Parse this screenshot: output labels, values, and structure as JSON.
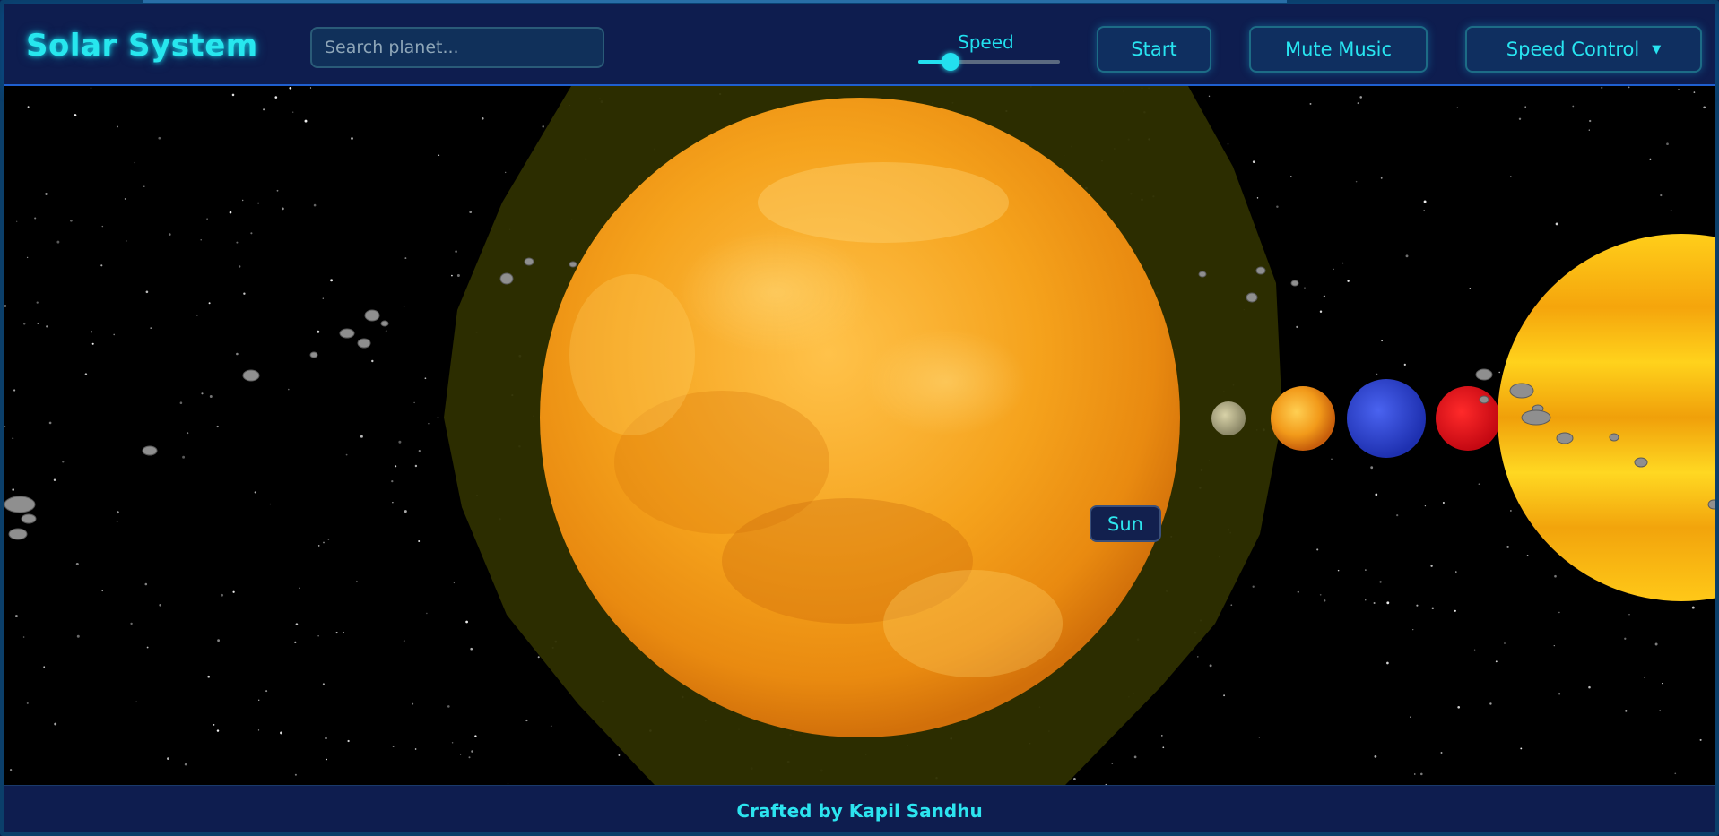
{
  "header": {
    "logo": "Solar System",
    "search_placeholder": "Search planet...",
    "speed_label": "Speed",
    "speed_value": 0.23,
    "start_label": "Start",
    "mute_label": "Mute Music",
    "speed_control_label": "Speed Control",
    "speed_control_caret": "▼"
  },
  "scene": {
    "hover_label": "Sun",
    "bodies": [
      "Sun",
      "Mercury",
      "Venus",
      "Earth",
      "Mars",
      "Jupiter"
    ]
  },
  "footer": {
    "credit": "Crafted by Kapil Sandhu"
  },
  "colors": {
    "accent": "#27e7ee",
    "header_bg": "#0e1d4f",
    "sun": "#f5a21c",
    "earth": "#2e46d8",
    "mars": "#e0101a",
    "jupiter": "#f5b60c"
  }
}
